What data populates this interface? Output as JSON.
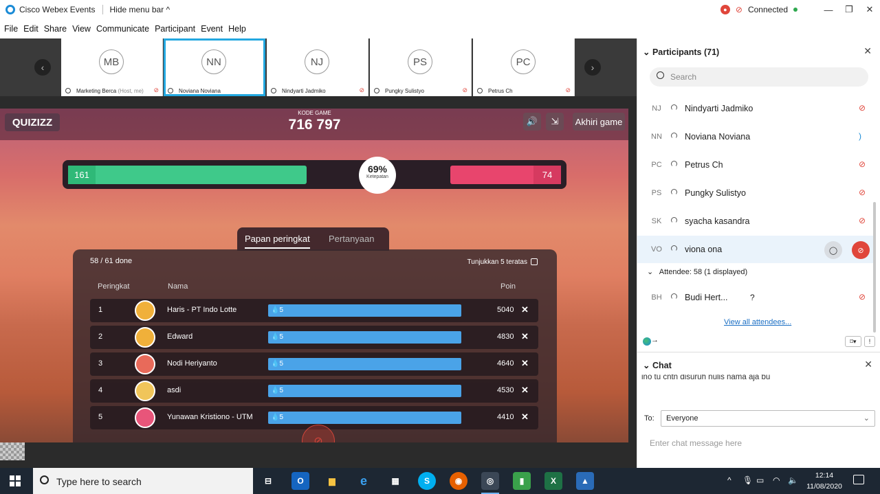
{
  "titlebar": {
    "app_title": "Cisco Webex Events",
    "hide_menu": "Hide menu bar ^",
    "status": "Connected",
    "status_color": "#2fa84f",
    "win_min": "—",
    "win_restore": "❐",
    "win_close": "✕"
  },
  "menubar": [
    "File",
    "Edit",
    "Share",
    "View",
    "Communicate",
    "Participant",
    "Event",
    "Help"
  ],
  "thumbnails": [
    {
      "initials": "MB",
      "name": "Marketing Berca",
      "suffix": "(Host, me)",
      "active": false
    },
    {
      "initials": "NN",
      "name": "Noviana Noviana",
      "suffix": "",
      "active": true
    },
    {
      "initials": "NJ",
      "name": "Nindyarti Jadmiko",
      "suffix": "",
      "active": false
    },
    {
      "initials": "PS",
      "name": "Pungky Sulistyo",
      "suffix": "",
      "active": false
    },
    {
      "initials": "PC",
      "name": "Petrus Ch",
      "suffix": "",
      "active": false
    }
  ],
  "quiz": {
    "logo": "QUIZIZZ",
    "kode_label": "KODE GAME",
    "kode_value": "716 797",
    "end_button": "Akhiri game",
    "correct_count": "161",
    "wrong_count": "74",
    "accuracy": "69%",
    "accuracy_label": "Ketepatan",
    "tab_leaderboard": "Papan peringkat",
    "tab_questions": "Pertanyaan",
    "done": "58 / 61 done",
    "top5": "Tunjukkan 5 teratas",
    "col_rank": "Peringkat",
    "col_name": "Nama",
    "col_points": "Poin",
    "rows": [
      {
        "rank": "1",
        "name": "Haris - PT Indo Lotte",
        "streak": "5",
        "points": "5040"
      },
      {
        "rank": "2",
        "name": "Edward",
        "streak": "5",
        "points": "4830"
      },
      {
        "rank": "3",
        "name": "Nodi Heriyanto",
        "streak": "5",
        "points": "4640"
      },
      {
        "rank": "4",
        "name": "asdi",
        "streak": "5",
        "points": "4530"
      },
      {
        "rank": "5",
        "name": "Yunawan Kristiono - UTM",
        "streak": "5",
        "points": "4410"
      }
    ]
  },
  "participants": {
    "header": "Participants (71)",
    "search_placeholder": "Search",
    "list": [
      {
        "initials": "NJ",
        "name": "Nindyarti Jadmiko",
        "mic": "muted"
      },
      {
        "initials": "NN",
        "name": "Noviana Noviana",
        "mic": "active"
      },
      {
        "initials": "PC",
        "name": "Petrus Ch",
        "mic": "muted"
      },
      {
        "initials": "PS",
        "name": "Pungky Sulistyo",
        "mic": "muted"
      },
      {
        "initials": "SK",
        "name": "syacha kasandra",
        "mic": "muted"
      },
      {
        "initials": "VO",
        "name": "viona ona",
        "mic": "muted"
      }
    ],
    "attendee_header": "Attendee: 58 (1 displayed)",
    "attendee": {
      "initials": "BH",
      "name": "Budi Hert...",
      "status": "?"
    },
    "view_all": "View all attendees..."
  },
  "chat": {
    "header": "Chat",
    "message": "ino tu cntn disuruh nulis nama aja bu",
    "to_label": "To:",
    "recipient": "Everyone",
    "input_placeholder": "Enter chat message here"
  },
  "taskbar": {
    "search_placeholder": "Type here to search",
    "time": "12:14",
    "date": "11/08/2020"
  }
}
